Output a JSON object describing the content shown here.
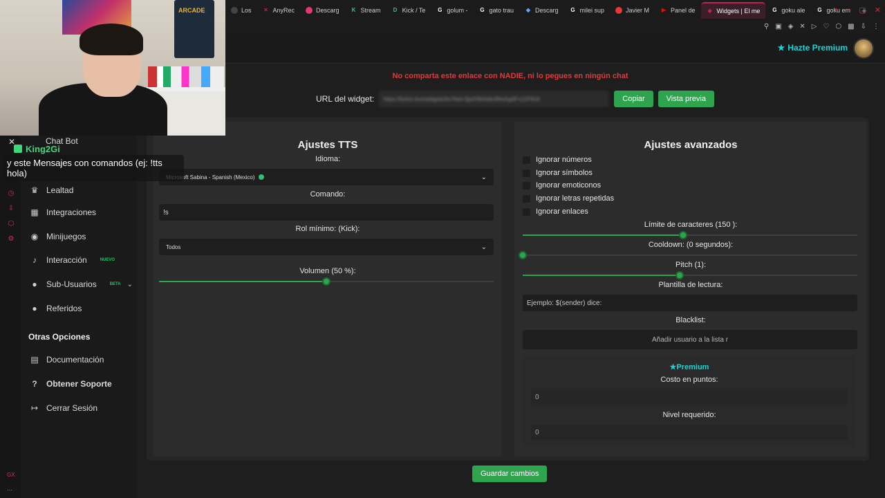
{
  "browser": {
    "tabs": [
      {
        "label": "Los",
        "color": "#444444",
        "glyph": ""
      },
      {
        "label": "AnyRec",
        "color": "#c0244c",
        "glyph": "✕"
      },
      {
        "label": "Descarg",
        "color": "#e03a6a",
        "glyph": ""
      },
      {
        "label": "Stream",
        "color": "#2ecc71",
        "glyph": "K"
      },
      {
        "label": "Kick / Te",
        "color": "#2ecc71",
        "glyph": "D"
      },
      {
        "label": "golum - ",
        "color": "#ffffff",
        "glyph": "G"
      },
      {
        "label": "gato trau",
        "color": "#ffffff",
        "glyph": "G"
      },
      {
        "label": "Descarg",
        "color": "#6aa0ff",
        "glyph": "◆"
      },
      {
        "label": "milei sup",
        "color": "#ffffff",
        "glyph": "G"
      },
      {
        "label": "Javier M",
        "color": "#e03a3a",
        "glyph": ""
      },
      {
        "label": "Panel de",
        "color": "#ff0000",
        "glyph": "▶"
      },
      {
        "label": "Widgets | El me",
        "color": "#c0244c",
        "glyph": "◆",
        "active": true
      },
      {
        "label": "goku ale",
        "color": "#ffffff",
        "glyph": "G"
      },
      {
        "label": "goku em",
        "color": "#ffffff",
        "glyph": "G"
      }
    ],
    "new_tab": "+"
  },
  "header": {
    "premium_label": "Hazte Premium"
  },
  "sidebar": {
    "chat_bot": "Chat Bot",
    "items": [
      {
        "label": "Lealtad",
        "icon": "trophy-icon",
        "glyph": "🏆"
      },
      {
        "label": "Integraciones",
        "icon": "puzzle-icon",
        "glyph": "▦"
      },
      {
        "label": "Minijuegos",
        "icon": "gamepad-icon",
        "glyph": "◉"
      },
      {
        "label": "Interacción",
        "icon": "music-icon",
        "glyph": "♪",
        "badge": "NUEVO"
      },
      {
        "label": "Sub-Usuarios",
        "icon": "users-icon",
        "glyph": "●",
        "badge": "BETA"
      },
      {
        "label": "Referidos",
        "icon": "user-group-icon",
        "glyph": "●"
      }
    ],
    "section_title": "Otras Opciones",
    "other": [
      {
        "label": "Documentación",
        "icon": "document-icon",
        "glyph": "▤"
      },
      {
        "label": "Obtener Soporte",
        "icon": "help-icon",
        "glyph": "?"
      },
      {
        "label": "Cerrar Sesión",
        "icon": "logout-icon",
        "glyph": "↦"
      }
    ]
  },
  "main": {
    "warning": "No comparta este enlace con NADIE, ni lo pegues en ningún chat",
    "url_label": "URL del widget:",
    "url_value": "https://botrix.live/widgets/tts?bid=3ja2f4b0a6c8fee5g6Fx1ZF8c8",
    "copy_label": "Copiar",
    "preview_label": "Vista previa",
    "save_label": "Guardar cambios"
  },
  "tts": {
    "title": "Ajustes TTS",
    "language_label": "Idioma:",
    "language_value": "Microsoft Sabina - Spanish (Mexico)",
    "command_label": "Comando:",
    "command_value": "!s",
    "role_label": "Rol mínimo: (Kick):",
    "role_value": "Todos",
    "volume_label": "Volumen (50 %):",
    "volume_percent": 50
  },
  "advanced": {
    "title": "Ajustes avanzados",
    "checkboxes": [
      "Ignorar números",
      "Ignorar símbolos",
      "Ignorar emoticonos",
      "Ignorar letras repetidas",
      "Ignorar enlaces"
    ],
    "char_limit_label": "Límite de caracteres (150 ):",
    "char_limit_fraction": 0.48,
    "cooldown_label": "Cooldown: (0 segundos):",
    "cooldown_fraction": 0,
    "pitch_label": "Pitch (1):",
    "pitch_fraction": 0.47,
    "template_label": "Plantilla de lectura:",
    "template_placeholder": "Ejemplo: $(sender) dice:",
    "blacklist_label": "Blacklist:",
    "blacklist_placeholder": "Añadir usuario a la lista r",
    "premium_title": "Premium",
    "cost_label": "Costo en puntos:",
    "cost_value": "0",
    "level_label": "Nivel requerido:",
    "level_value": "0"
  },
  "overlay": {
    "chat_user": "King2Gi",
    "chat_message": "y este Mensajes con comandos (ej: !tts hola)",
    "webcam_sign": "ARCADE"
  },
  "colors": {
    "accent_green": "#2ea44f",
    "premium_cyan": "#19d6d6",
    "warning_red": "#e03a3a"
  }
}
